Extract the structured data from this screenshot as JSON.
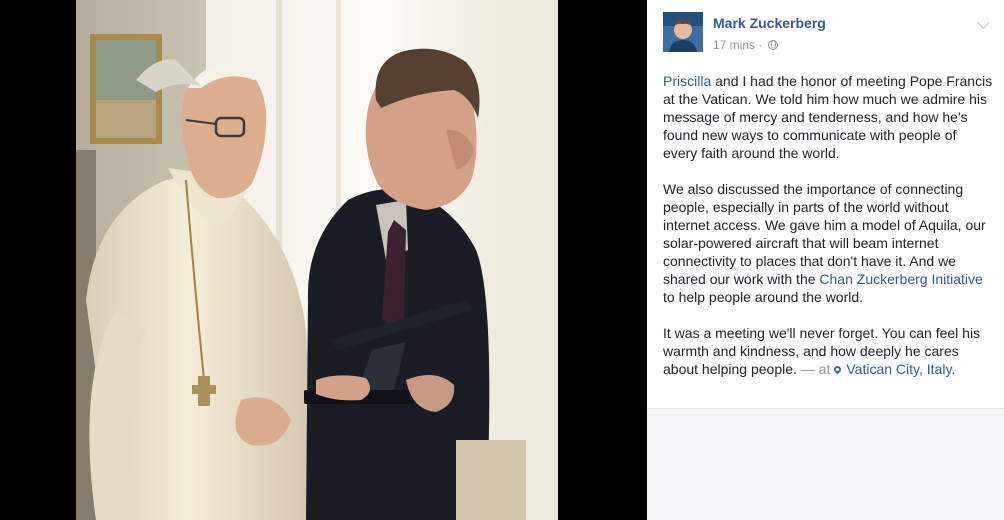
{
  "post": {
    "author": "Mark Zuckerberg",
    "timestamp": "17 mins",
    "separator": "·",
    "paragraph1": {
      "mention": "Priscilla",
      "text": " and I had the honor of meeting Pope Francis at the Vatican. We told him how much we admire his message of mercy and tenderness, and how he's found new ways to communicate with people of every faith around the world."
    },
    "paragraph2": {
      "text_before": "We also discussed the importance of connecting people, especially in parts of the world without internet access. We gave him a model of Aquila, our solar-powered aircraft that will beam internet connectivity to places that don't have it. And we shared our work with the ",
      "link": "Chan Zuckerberg Initiative",
      "text_after": " to help people around the world."
    },
    "paragraph3": {
      "text": "It was a meeting we'll never forget. You can feel his warmth and kindness, and how deeply he cares about helping people.",
      "at_text": " — at",
      "location": "Vatican City, Italy."
    }
  },
  "icons": {
    "privacy": "globe-icon",
    "menu": "chevron-down-icon",
    "location": "map-pin-icon"
  },
  "colors": {
    "link": "#365899",
    "meta": "#90949c",
    "text": "#1d2129"
  }
}
